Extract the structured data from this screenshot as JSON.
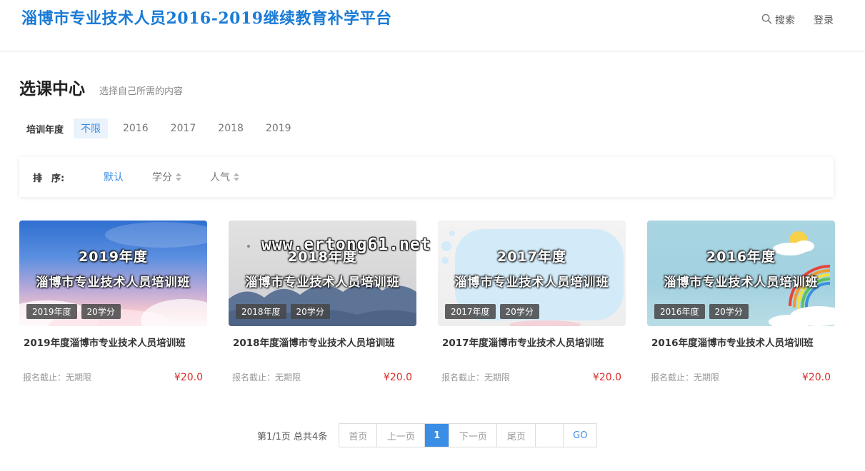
{
  "header": {
    "site_title": "淄博市专业技术人员2016-2019继续教育补学平台",
    "search_label": "搜索",
    "login_label": "登录"
  },
  "section": {
    "title": "选课中心",
    "subtitle": "选择自己所需的内容"
  },
  "filter": {
    "label": "培训年度",
    "options": [
      "不限",
      "2016",
      "2017",
      "2018",
      "2019"
    ],
    "selected": "不限"
  },
  "sort": {
    "label": "排　序:",
    "options": [
      "默认",
      "学分",
      "人气"
    ],
    "selected": "默认"
  },
  "watermark": "www.ertong61.net",
  "cards": [
    {
      "banner_year": "2019年度",
      "banner_name": "淄博市专业技术人员培训班",
      "year_badge": "2019年度",
      "credit_badge": "20学分",
      "title": "2019年度淄博市专业技术人员培训班",
      "deadline": "报名截止：无期限",
      "price": "¥20.0"
    },
    {
      "banner_year": "2018年度",
      "banner_name": "淄博市专业技术人员培训班",
      "year_badge": "2018年度",
      "credit_badge": "20学分",
      "title": "2018年度淄博市专业技术人员培训班",
      "deadline": "报名截止：无期限",
      "price": "¥20.0"
    },
    {
      "banner_year": "2017年度",
      "banner_name": "淄博市专业技术人员培训班",
      "year_badge": "2017年度",
      "credit_badge": "20学分",
      "title": "2017年度淄博市专业技术人员培训班",
      "deadline": "报名截止：无期限",
      "price": "¥20.0"
    },
    {
      "banner_year": "2016年度",
      "banner_name": "淄博市专业技术人员培训班",
      "year_badge": "2016年度",
      "credit_badge": "20学分",
      "title": "2016年度淄博市专业技术人员培训班",
      "deadline": "报名截止：无期限",
      "price": "¥20.0"
    }
  ],
  "pager": {
    "info": "第1/1页 总共4条",
    "first": "首页",
    "prev": "上一页",
    "current": "1",
    "next": "下一页",
    "last": "尾页",
    "go": "GO"
  },
  "colors": {
    "brand": "#1a7bd6",
    "accent": "#3a8ee6",
    "price": "#d9302c"
  }
}
